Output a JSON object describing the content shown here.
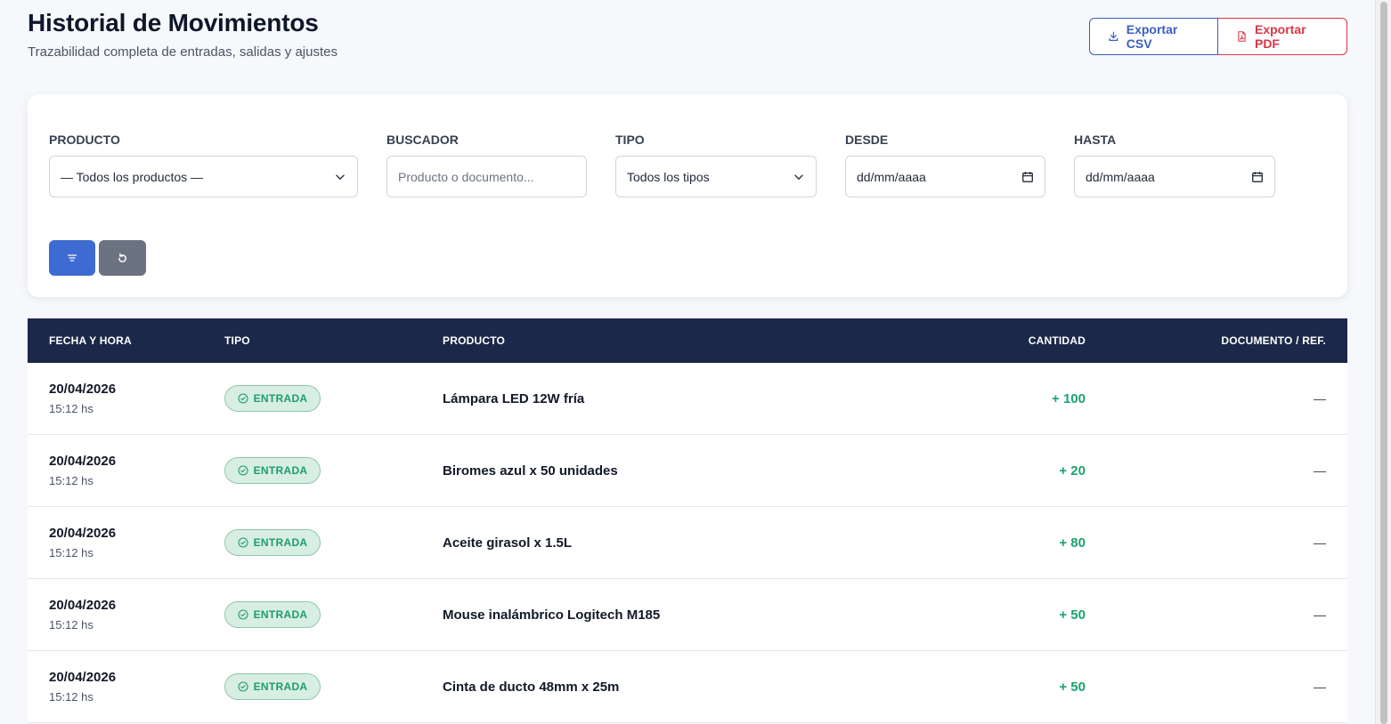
{
  "header": {
    "title": "Historial de Movimientos",
    "subtitle": "Trazabilidad completa de entradas, salidas y ajustes"
  },
  "actions": {
    "export_csv": "Exportar CSV",
    "export_pdf": "Exportar PDF"
  },
  "filters": {
    "producto": {
      "label": "PRODUCTO",
      "value": "— Todos los productos —"
    },
    "buscador": {
      "label": "BUSCADOR",
      "placeholder": "Producto o documento..."
    },
    "tipo": {
      "label": "TIPO",
      "value": "Todos los tipos"
    },
    "desde": {
      "label": "DESDE",
      "placeholder": "dd/mm/aaaa"
    },
    "hasta": {
      "label": "HASTA",
      "placeholder": "dd/mm/aaaa"
    }
  },
  "table": {
    "columns": [
      "FECHA Y HORA",
      "TIPO",
      "PRODUCTO",
      "CANTIDAD",
      "DOCUMENTO / REF."
    ],
    "rows": [
      {
        "fecha": "20/04/2026",
        "hora": "15:12 hs",
        "tipo": "ENTRADA",
        "producto": "Lámpara LED 12W fría",
        "cantidad": "+ 100",
        "documento": "—"
      },
      {
        "fecha": "20/04/2026",
        "hora": "15:12 hs",
        "tipo": "ENTRADA",
        "producto": "Biromes azul x 50 unidades",
        "cantidad": "+ 20",
        "documento": "—"
      },
      {
        "fecha": "20/04/2026",
        "hora": "15:12 hs",
        "tipo": "ENTRADA",
        "producto": "Aceite girasol x 1.5L",
        "cantidad": "+ 80",
        "documento": "—"
      },
      {
        "fecha": "20/04/2026",
        "hora": "15:12 hs",
        "tipo": "ENTRADA",
        "producto": "Mouse inalámbrico Logitech M185",
        "cantidad": "+ 50",
        "documento": "—"
      },
      {
        "fecha": "20/04/2026",
        "hora": "15:12 hs",
        "tipo": "ENTRADA",
        "producto": "Cinta de ducto 48mm x 25m",
        "cantidad": "+ 50",
        "documento": "—"
      }
    ]
  },
  "colors": {
    "primary": "#3e6bd1",
    "header_bg": "#1b2849",
    "entrada": "#1aa36c",
    "pdf": "#dc3545"
  }
}
